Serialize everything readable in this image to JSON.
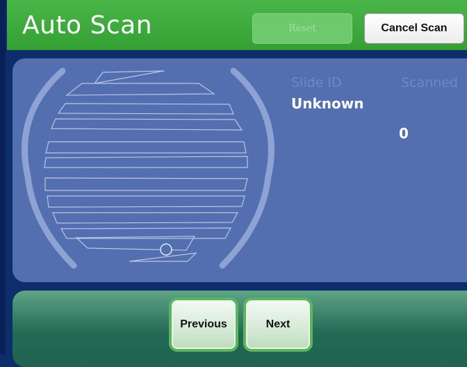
{
  "header": {
    "title": "Auto Scan",
    "reset_label": "Reset",
    "cancel_label": "Cancel Scan"
  },
  "info": {
    "slide_id_label": "Slide ID",
    "slide_id_value": "Unknown",
    "scanned_label": "Scanned",
    "scanned_value": "0"
  },
  "footer": {
    "previous_label": "Previous",
    "next_label": "Next"
  },
  "colors": {
    "header_green": "#3aa83a",
    "panel_blue": "#546fb0",
    "button_border": "#5cb45c"
  }
}
